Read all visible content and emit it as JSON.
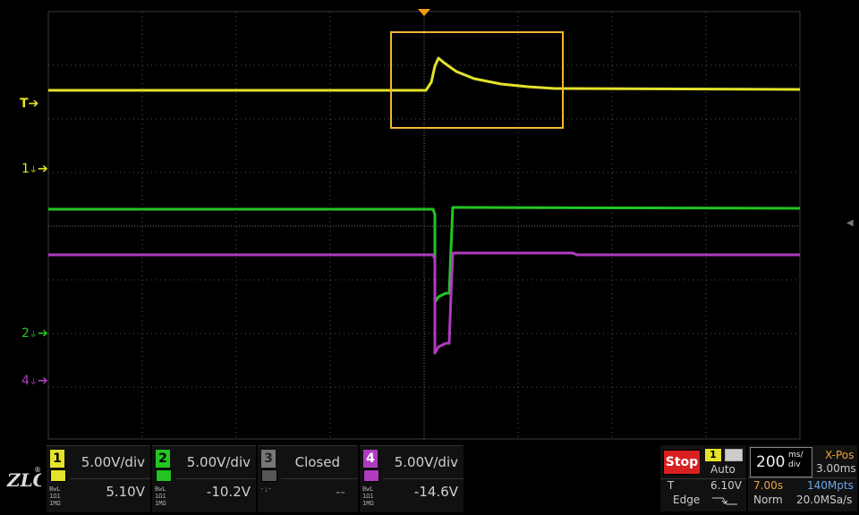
{
  "colors": {
    "ch1": "#e5e22a",
    "ch2": "#22c522",
    "ch3": "#9a9a9a",
    "ch4": "#b03bc0",
    "trigger_marker": "#f39c12",
    "zoom_box": "#f5b731",
    "stop_bg": "#d92020",
    "grid": "#5a5a5a"
  },
  "markers": {
    "trigger_level": "T",
    "ch1": "1",
    "ch2": "2",
    "ch4": "4",
    "ground_sub": "⏚"
  },
  "channels": [
    {
      "num": "1",
      "vdiv": "5.00V/div",
      "offset": "5.10V",
      "tiny": "BwL\n1Ω1\n1MΩ"
    },
    {
      "num": "2",
      "vdiv": "5.00V/div",
      "offset": "-10.2V",
      "tiny": "BwL\n1Ω1\n1MΩ"
    },
    {
      "num": "3",
      "vdiv": "Closed",
      "offset": "--",
      "tiny": "-;-"
    },
    {
      "num": "4",
      "vdiv": "5.00V/div",
      "offset": "-14.6V",
      "tiny": "BwL\n1Ω1\n1MΩ"
    }
  ],
  "trigger": {
    "state": "Stop",
    "source": "1",
    "mode": "Auto",
    "level_label": "T",
    "level": "6.10V",
    "type": "Edge"
  },
  "timebase": {
    "scale": "200",
    "unit_top": "ms/",
    "unit_bot": "div",
    "xpos_label": "X-Pos",
    "xpos": "3.00ms",
    "time": "7.00s",
    "memory": "140Mpts",
    "acq": "Norm",
    "rate": "20.0MSa/s"
  },
  "logo": {
    "text": "ZLG",
    "reg": "®"
  }
}
